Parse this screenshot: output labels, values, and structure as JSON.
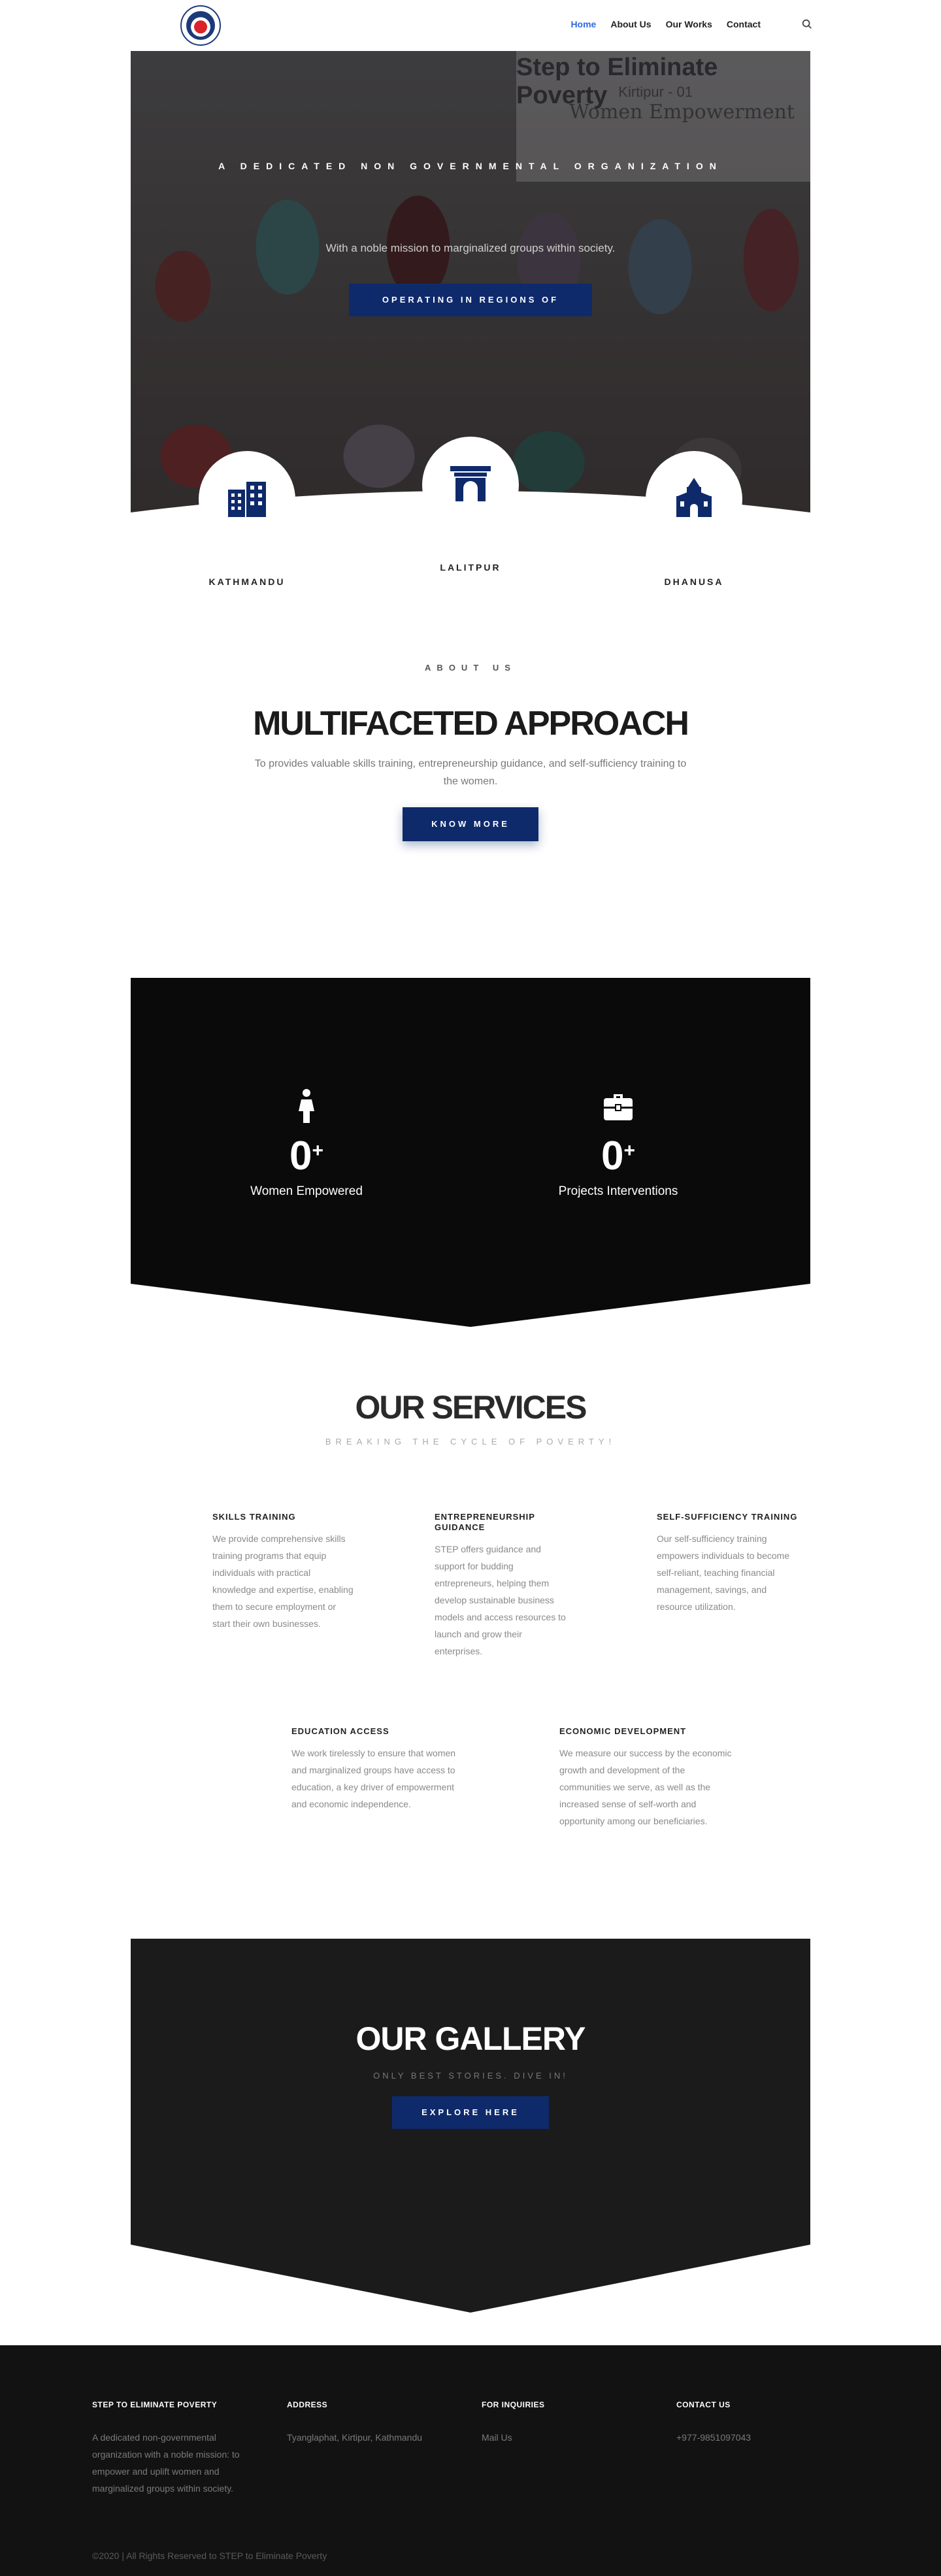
{
  "nav": {
    "items": [
      {
        "label": "Home",
        "active": true
      },
      {
        "label": "About Us"
      },
      {
        "label": "Our Works"
      },
      {
        "label": "Contact"
      }
    ],
    "search_icon": "search-icon",
    "accent_color": "#2d6be0"
  },
  "hero": {
    "sign_title": "Step to Eliminate Poverty",
    "sign_sub": "Kirtipur - 01",
    "sign_text": "Women Empowerment",
    "tagline": "A DEDICATED NON GOVERNMENTAL ORGANIZATION",
    "description": "With a noble mission to marginalized groups within society.",
    "button": "OPERATING IN REGIONS OF",
    "regions": [
      {
        "label": "KATHMANDU",
        "icon": "buildings-icon"
      },
      {
        "label": "LALITPUR",
        "icon": "gate-icon"
      },
      {
        "label": "DHANUSA",
        "icon": "temple-icon"
      }
    ]
  },
  "about": {
    "eyebrow": "ABOUT US",
    "title": "MULTIFACETED APPROACH",
    "text": "To provides valuable skills training, entrepreneurship guidance, and self-sufficiency training to the women.",
    "button": "KNOW MORE"
  },
  "stats": [
    {
      "icon": "woman-icon",
      "value": "0",
      "suffix": "+",
      "label": "Women Empowered"
    },
    {
      "icon": "briefcase-icon",
      "value": "0",
      "suffix": "+",
      "label": "Projects Interventions"
    }
  ],
  "services": {
    "title": "OUR SERVICES",
    "subtitle": "BREAKING THE CYCLE OF POVERTY!",
    "items": [
      {
        "title": "SKILLS TRAINING",
        "text": "We provide comprehensive skills training programs that equip individuals with practical knowledge and expertise, enabling them to secure employment or start their own businesses."
      },
      {
        "title": "ENTREPRENEURSHIP GUIDANCE",
        "text": "STEP offers guidance and support for budding entrepreneurs, helping them develop sustainable business models and access resources to launch and grow their enterprises."
      },
      {
        "title": "SELF-SUFFICIENCY TRAINING",
        "text": "Our self-sufficiency training empowers individuals to become self-reliant, teaching financial management, savings, and resource utilization."
      },
      {
        "title": "EDUCATION ACCESS",
        "text": "We work tirelessly to ensure that women and marginalized groups have access to education, a key driver of empowerment and economic independence."
      },
      {
        "title": "ECONOMIC DEVELOPMENT",
        "text": "We measure our success by the economic growth and development of the communities we serve, as well as the increased sense of self-worth and opportunity among our beneficiaries."
      }
    ]
  },
  "gallery": {
    "title": "OUR GALLERY",
    "subtitle": "ONLY BEST STORIES. DIVE IN!",
    "button": "EXPLORE HERE"
  },
  "footer": {
    "cols": [
      {
        "title": "STEP TO ELIMINATE POVERTY",
        "text": "A dedicated non-governmental organization with a noble mission: to empower and uplift women and marginalized groups within society."
      },
      {
        "title": "ADDRESS",
        "text": "Tyanglaphat, Kirtipur, Kathmandu"
      },
      {
        "title": "FOR INQUIRIES",
        "text": "Mail Us"
      },
      {
        "title": "CONTACT US",
        "text": "+977-9851097043"
      }
    ],
    "copyright": "©2020 | All Rights Reserved to STEP to Eliminate Poverty"
  },
  "colors": {
    "brand": "#0f2a6b",
    "dark": "#0a0a0a",
    "gallery_bg": "#1b1b1b",
    "footer_bg": "#121212"
  }
}
